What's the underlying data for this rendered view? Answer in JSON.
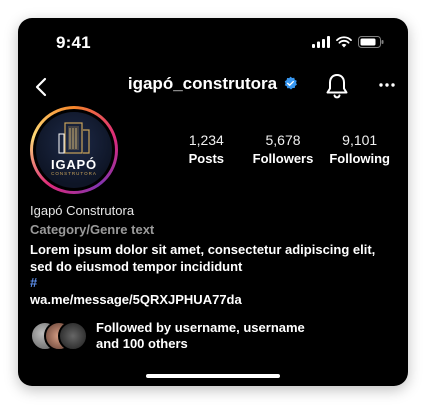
{
  "status": {
    "time": "9:41",
    "icons": [
      "cellular-signal-icon",
      "wifi-icon",
      "battery-icon"
    ]
  },
  "header": {
    "username": "igapó_construtora",
    "verified": true,
    "icons": [
      "back-arrow-icon",
      "verified-badge-icon",
      "bell-icon",
      "more-options-icon"
    ]
  },
  "profile": {
    "logo_name": "IGAPÓ",
    "logo_tagline": "CONSTRUTORA",
    "stats": [
      {
        "value": "1,234",
        "label": "Posts"
      },
      {
        "value": "5,678",
        "label": "Followers"
      },
      {
        "value": "9,101",
        "label": "Following"
      }
    ]
  },
  "bio": {
    "display_name": "Igapó Construtora",
    "category": "Category/Genre text",
    "text": "Lorem ipsum dolor sit amet, consectetur adipiscing elit, sed do eiusmod tempor incididunt",
    "hashtag": "#",
    "link": "wa.me/message/5QRXJPHUA77da"
  },
  "followed_by": {
    "line1": "Followed by username, username",
    "line2": "and 100 others"
  },
  "colors": {
    "background": "#000000",
    "text": "#ffffff",
    "category": "#9a9a9a",
    "hashtag": "#5b8de8",
    "verified": "#3897f0",
    "logo_gold": "#c9a35a"
  }
}
